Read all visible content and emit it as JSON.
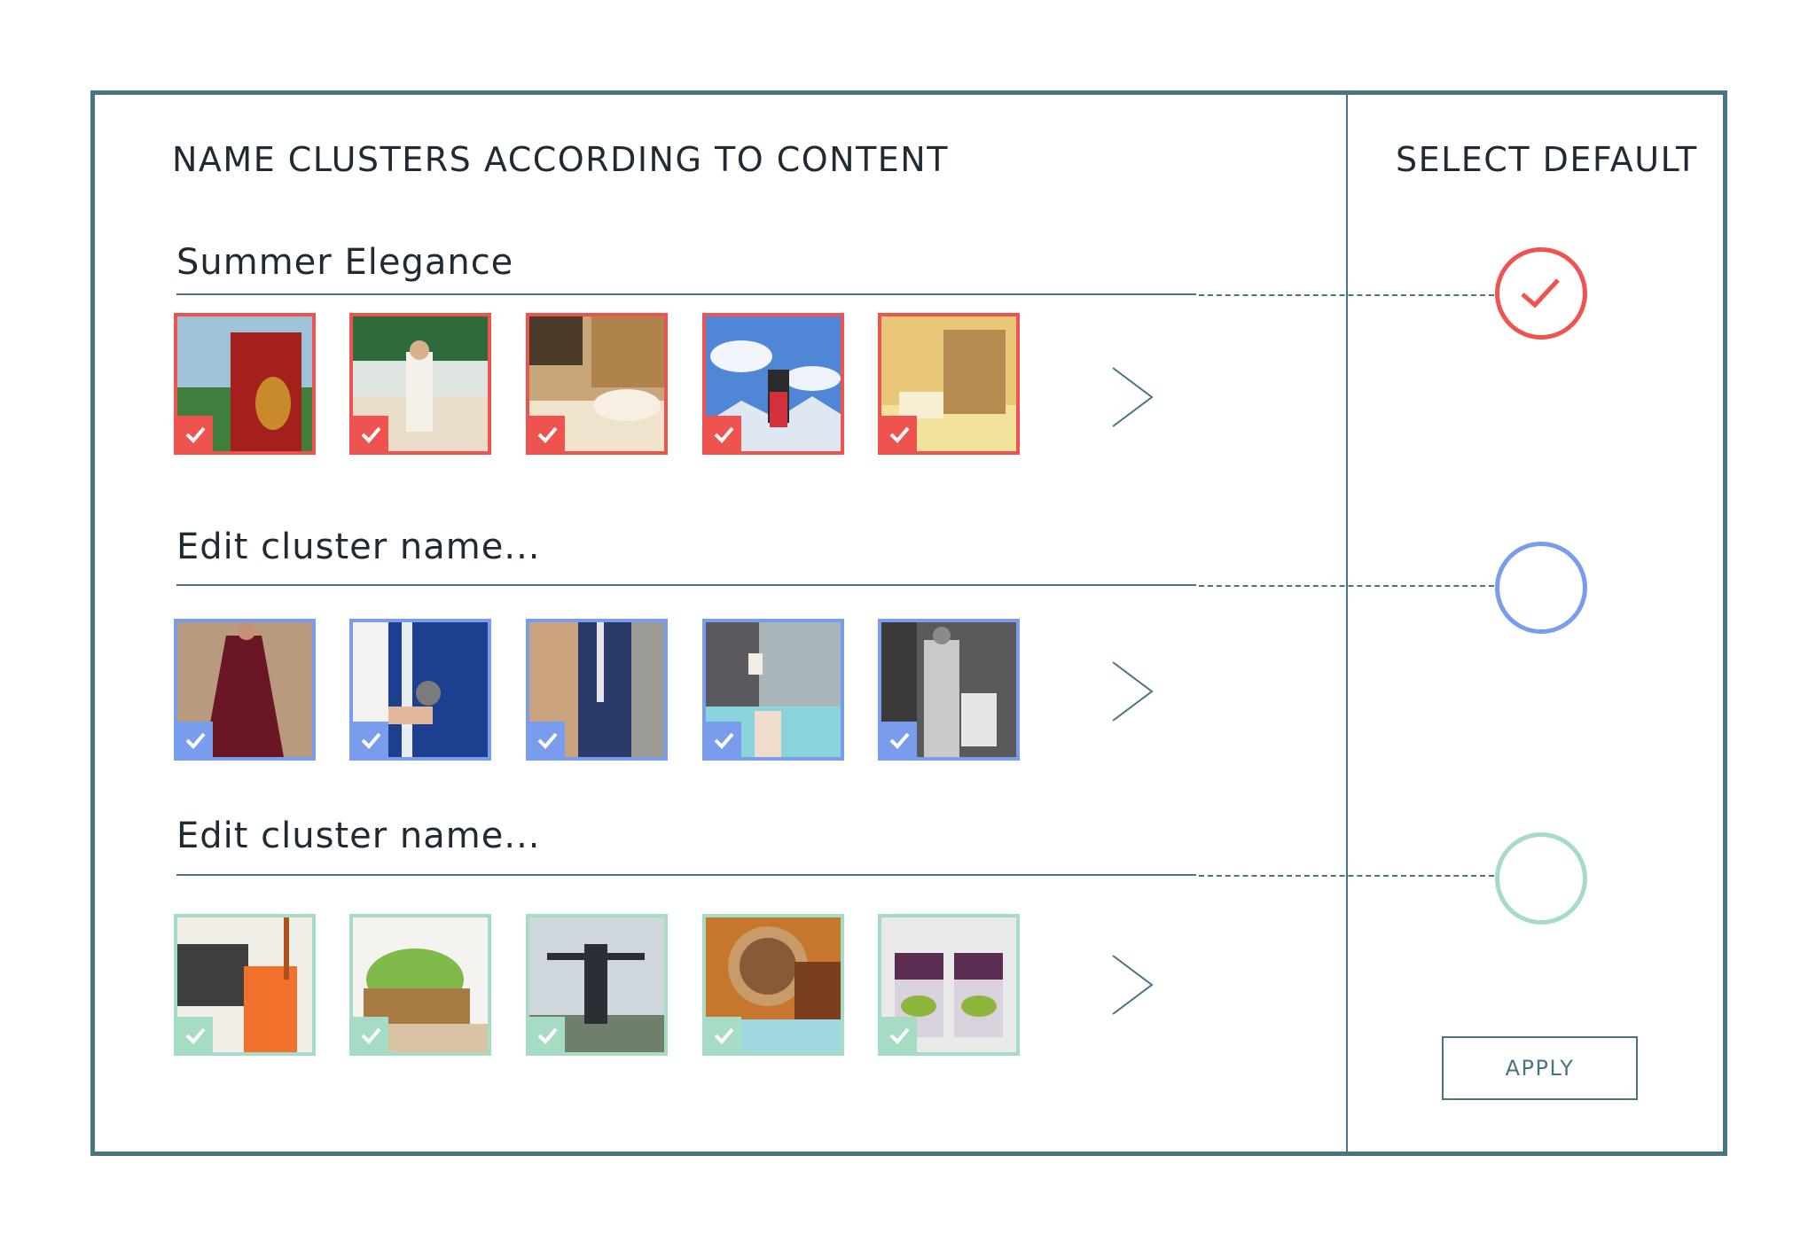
{
  "left_heading": "NAME CLUSTERS ACCORDING TO CONTENT",
  "right_heading": "SELECT DEFAULT",
  "apply_label": "APPLY",
  "clusters": [
    {
      "name": "Summer Elegance",
      "accent": "#ef5350",
      "selected_default": true,
      "photos": [
        "red-robe-beach-photo",
        "woman-on-beach-photo",
        "woman-lounging-photo",
        "skier-arms-raised-photo",
        "straw-bag-photo"
      ]
    },
    {
      "name": "Edit cluster name...",
      "accent": "#7a9cec",
      "selected_default": false,
      "photos": [
        "burgundy-dress-photo",
        "blue-suit-watch-photo",
        "camel-coat-suit-photo",
        "woman-with-coffee-photo",
        "man-in-suit-street-photo"
      ]
    },
    {
      "name": "Edit cluster name...",
      "accent": "#a6dcc4",
      "selected_default": false,
      "photos": [
        "orange-juice-jar-photo",
        "basket-of-limes-photo",
        "traveler-photo",
        "coffee-cup-photo",
        "fruit-parfait-photo"
      ]
    }
  ]
}
